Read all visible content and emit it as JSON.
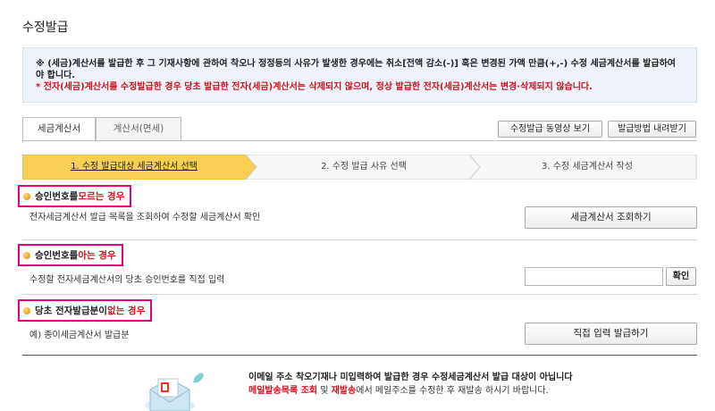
{
  "page": {
    "title": "수정발급"
  },
  "notice": {
    "line1": "※ (세금)계산서를 발급한 후 그 기재사항에 관하여 착오나 정정등의 사유가 발생한 경우에는 취소[전액 감소(-)] 혹은 변경된 가액 만큼(+,-) 수정 세금계산서를 발급하여야 합니다.",
    "line2": "* 전자(세금)계산서를 수정발급한 경우 당초 발급한 전자(세금)계산서는 삭제되지 않으며, 정상 발급한 전자(세금)계산서는 변경·삭제되지 않습니다."
  },
  "tabs": [
    {
      "label": "세금계산서",
      "active": true
    },
    {
      "label": "계산서(면세)",
      "active": false
    }
  ],
  "toolbar": {
    "video_label": "수정발급 동영상 보기",
    "method_label": "발급방법 내려받기"
  },
  "steps": [
    {
      "label": "1. 수정 발급대상 세금계산서 선택",
      "active": true
    },
    {
      "label": "2. 수정 발급 사유 선택",
      "active": false
    },
    {
      "label": "3. 수정 세금계산서 작성",
      "active": false
    }
  ],
  "sections": {
    "unknown": {
      "head_prefix": "승인번호를 ",
      "head_emph": "모르는 경우",
      "desc": "전자세금계산서 발급 목록을 조회하여 수정할 세금계산서 확인",
      "button": "세금계산서 조회하기"
    },
    "known": {
      "head_prefix": "승인번호를 ",
      "head_emph": "아는 경우",
      "desc": "수정할 전자세금계산서의 당초 승인번호를 직접 입력",
      "input_value": "",
      "button": "확인"
    },
    "none": {
      "head_prefix": "당초 전자발급분이 ",
      "head_emph": "없는 경우",
      "desc": "예) 종이세금계산서 발급분",
      "button": "직접 입력 발급하기"
    }
  },
  "footer": {
    "line1": "이메일 주소 착오기재나 미입력하여 발급한 경우 수정세금계산서 발급 대상이 아닙니다",
    "line2_red1": "메일발송목록 조회",
    "line2_mid": " 및 ",
    "line2_red2": "재발송",
    "line2_rest": "에서 메일주소를 수정한 후 재발송 하시기 바랍니다."
  },
  "colors": {
    "accent_highlight": "#e4007f",
    "warning_red": "#d0121b",
    "step_active": "#f8cf52",
    "notice_bg": "#eef3fb"
  },
  "icons": {
    "section_bullet": "orange-dot-icon",
    "footer": "envelope-document-icon"
  }
}
